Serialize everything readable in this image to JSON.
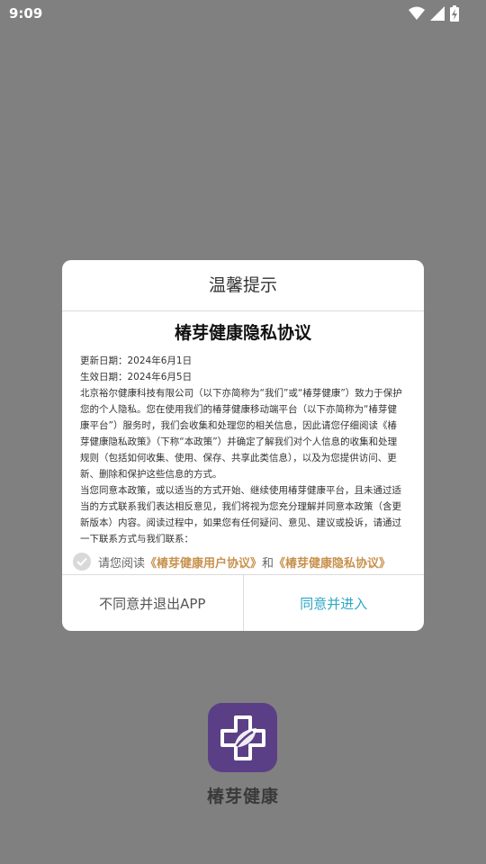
{
  "status_bar": {
    "time": "9:09"
  },
  "dialog": {
    "title": "温馨提示",
    "policy_title": "椿芽健康隐私协议",
    "policy_lines": [
      "更新日期：2024年6月1日",
      "生效日期：2024年6月5日",
      "北京裕尔健康科技有限公司（以下亦简称为“我们”或“椿芽健康”）致力于保护您的个人隐私。您在使用我们的椿芽健康移动端平台（以下亦简称为“椿芽健康平台”）服务时，我们会收集和处理您的相关信息，因此请您仔细阅读《椿芽健康隐私政策》（下称“本政策”）并确定了解我们对个人信息的收集和处理规则（包括如何收集、使用、保存、共享此类信息），以及为您提供访问、更新、删除和保护这些信息的方式。",
      "当您同意本政策，或以适当的方式开始、继续使用椿芽健康平台，且未通过适当的方式联系我们表达相反意见，我们将视为您充分理解并同意本政策（含更新版本）内容。阅读过程中，如果您有任何疑问、意见、建议或投诉，请通过一下联系方式与我们联系："
    ],
    "consent": {
      "prefix": "请您阅读",
      "user_agreement": "《椿芽健康用户协议》",
      "and": "和",
      "privacy_agreement": "《椿芽健康隐私协议》"
    },
    "decline_label": "不同意并退出APP",
    "accept_label": "同意并进入"
  },
  "app": {
    "name": "椿芽健康",
    "logo_color": "#5b3f86"
  },
  "colors": {
    "accent": "#2ea7c4",
    "link": "#c8914e",
    "overlay": "#808080"
  }
}
